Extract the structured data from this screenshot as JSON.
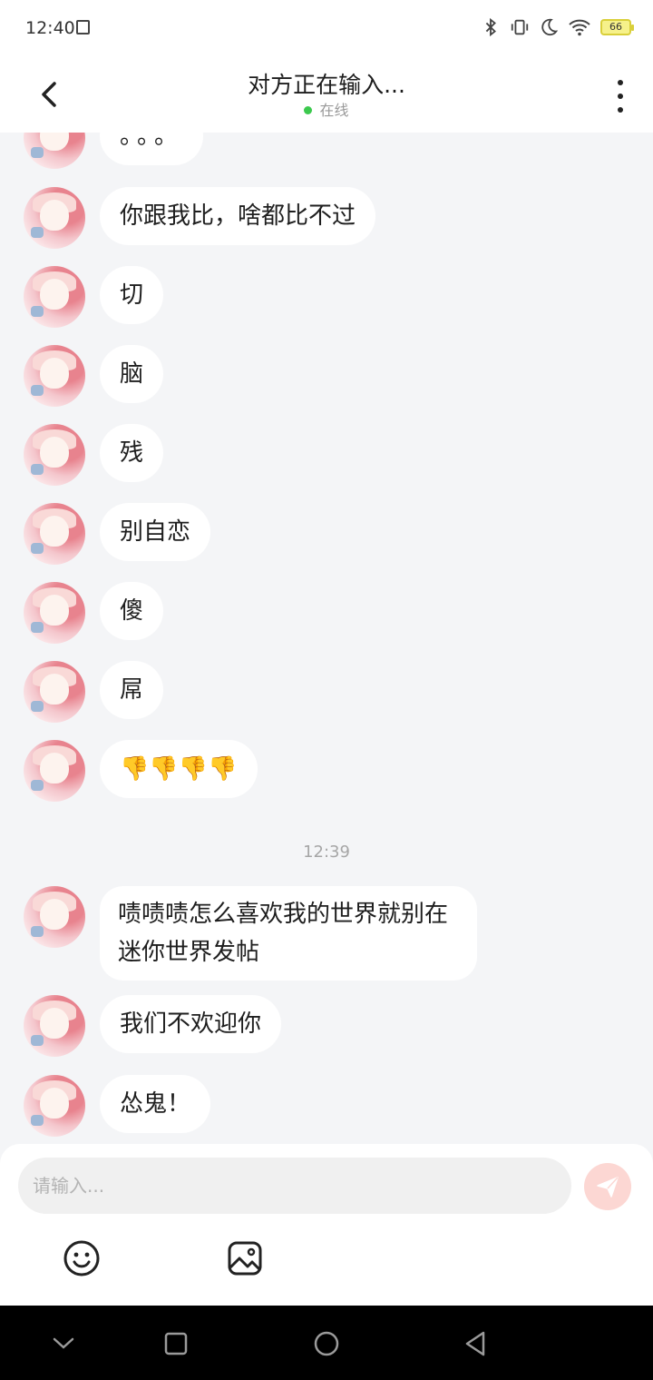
{
  "status_bar": {
    "time": "12:40",
    "battery": "66",
    "icons": [
      "save-icon",
      "bluetooth-icon",
      "vibrate-icon",
      "moon-icon",
      "wifi-icon",
      "battery-icon"
    ]
  },
  "header": {
    "title": "对方正在输入...",
    "status": "在线",
    "icons": [
      "back-icon",
      "more-icon"
    ],
    "status_color": "#3cc94e"
  },
  "messages": [
    {
      "text": "。。。"
    },
    {
      "text": "你跟我比，啥都比不过"
    },
    {
      "text": "切"
    },
    {
      "text": "脑"
    },
    {
      "text": "残"
    },
    {
      "text": "别自恋"
    },
    {
      "text": "傻"
    },
    {
      "text": "屌"
    },
    {
      "text": "👎👎👎👎"
    },
    {
      "text": "啧啧啧怎么喜欢我的世界就别在迷你世界发帖"
    },
    {
      "text": "我们不欢迎你"
    },
    {
      "text": "怂鬼！"
    }
  ],
  "timestamp": "12:39",
  "composer": {
    "placeholder": "请输入...",
    "icons": [
      "send-icon",
      "emoji-icon",
      "image-icon"
    ],
    "send_color": "#fcd7d3"
  },
  "nav_bar": {
    "icons": [
      "nav-collapse-icon",
      "nav-recents-icon",
      "nav-home-icon",
      "nav-back-icon"
    ]
  }
}
